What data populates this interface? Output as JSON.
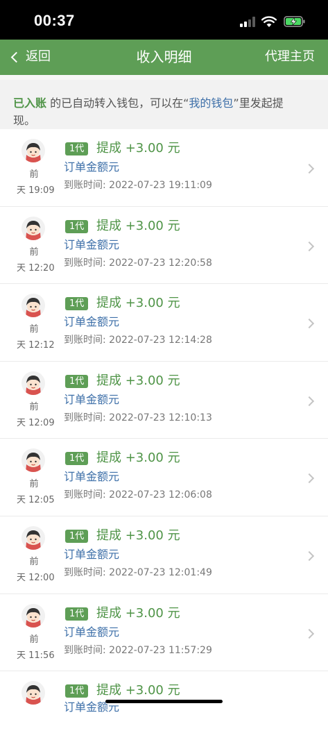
{
  "status_bar": {
    "time": "00:37"
  },
  "nav": {
    "back_label": "返回",
    "title": "收入明细",
    "right_label": "代理主页"
  },
  "notice": {
    "highlight": "已入账",
    "text_1": " 的已自动转入钱包，可以在“",
    "wallet_link": "我的钱包",
    "text_2": "”里发起提现。"
  },
  "records": [
    {
      "day_label": "前",
      "time_label": "天 19:09",
      "badge": "1代",
      "commission": "提成 +3.00 元",
      "order_amount": "订单金额元",
      "arrival_time": "到账时间: 2022-07-23 19:11:09"
    },
    {
      "day_label": "前",
      "time_label": "天 12:20",
      "badge": "1代",
      "commission": "提成 +3.00 元",
      "order_amount": "订单金额元",
      "arrival_time": "到账时间: 2022-07-23 12:20:58"
    },
    {
      "day_label": "前",
      "time_label": "天 12:12",
      "badge": "1代",
      "commission": "提成 +3.00 元",
      "order_amount": "订单金额元",
      "arrival_time": "到账时间: 2022-07-23 12:14:28"
    },
    {
      "day_label": "前",
      "time_label": "天 12:09",
      "badge": "1代",
      "commission": "提成 +3.00 元",
      "order_amount": "订单金额元",
      "arrival_time": "到账时间: 2022-07-23 12:10:13"
    },
    {
      "day_label": "前",
      "time_label": "天 12:05",
      "badge": "1代",
      "commission": "提成 +3.00 元",
      "order_amount": "订单金额元",
      "arrival_time": "到账时间: 2022-07-23 12:06:08"
    },
    {
      "day_label": "前",
      "time_label": "天 12:00",
      "badge": "1代",
      "commission": "提成 +3.00 元",
      "order_amount": "订单金额元",
      "arrival_time": "到账时间: 2022-07-23 12:01:49"
    },
    {
      "day_label": "前",
      "time_label": "天 11:56",
      "badge": "1代",
      "commission": "提成 +3.00 元",
      "order_amount": "订单金额元",
      "arrival_time": "到账时间: 2022-07-23 11:57:29"
    },
    {
      "day_label": "",
      "time_label": "",
      "badge": "1代",
      "commission": "提成 +3.00 元",
      "order_amount": "订单金额元",
      "arrival_time": ""
    }
  ],
  "colors": {
    "brand_green": "#5e9e56",
    "text_green": "#4f9447",
    "link_blue": "#3d6fa8"
  }
}
